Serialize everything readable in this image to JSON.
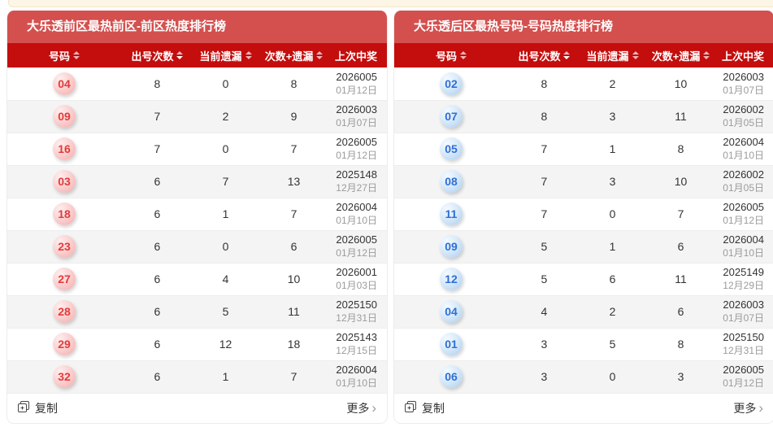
{
  "theme": {
    "title_bg": "#d4504e",
    "header_bg": "#c40d0d",
    "notice_bg": "#fdf6e6",
    "notice_border": "#f3e6c8",
    "sort_inactive": "#f0b6b6",
    "sort_active": "#ffffff",
    "ball_red_text": "#e23b3b",
    "ball_blue_text": "#2f6fd4"
  },
  "columns": [
    {
      "key": "number",
      "label": "号码",
      "sortable": true
    },
    {
      "key": "times",
      "label": "出号次数",
      "sortable": true,
      "active": "desc"
    },
    {
      "key": "current-miss",
      "label": "当前遗漏",
      "sortable": true
    },
    {
      "key": "times-plus-miss",
      "label": "次数+遗漏",
      "sortable": true
    },
    {
      "key": "last-win",
      "label": "上次中奖",
      "sortable": false
    }
  ],
  "footer": {
    "copy_label": "复制",
    "copy_icon": "copy-icon",
    "more_label": "更多",
    "more_chevron": "›"
  },
  "panels": [
    {
      "title": "大乐透前区最热前区-前区热度排行榜",
      "ball": "red",
      "rows": [
        {
          "num": "04",
          "times": "8",
          "miss": "0",
          "sum": "8",
          "period": "2026005",
          "date": "01月12日"
        },
        {
          "num": "09",
          "times": "7",
          "miss": "2",
          "sum": "9",
          "period": "2026003",
          "date": "01月07日"
        },
        {
          "num": "16",
          "times": "7",
          "miss": "0",
          "sum": "7",
          "period": "2026005",
          "date": "01月12日"
        },
        {
          "num": "03",
          "times": "6",
          "miss": "7",
          "sum": "13",
          "period": "2025148",
          "date": "12月27日"
        },
        {
          "num": "18",
          "times": "6",
          "miss": "1",
          "sum": "7",
          "period": "2026004",
          "date": "01月10日"
        },
        {
          "num": "23",
          "times": "6",
          "miss": "0",
          "sum": "6",
          "period": "2026005",
          "date": "01月12日"
        },
        {
          "num": "27",
          "times": "6",
          "miss": "4",
          "sum": "10",
          "period": "2026001",
          "date": "01月03日"
        },
        {
          "num": "28",
          "times": "6",
          "miss": "5",
          "sum": "11",
          "period": "2025150",
          "date": "12月31日"
        },
        {
          "num": "29",
          "times": "6",
          "miss": "12",
          "sum": "18",
          "period": "2025143",
          "date": "12月15日"
        },
        {
          "num": "32",
          "times": "6",
          "miss": "1",
          "sum": "7",
          "period": "2026004",
          "date": "01月10日"
        }
      ]
    },
    {
      "title": "大乐透后区最热号码-号码热度排行榜",
      "ball": "blue",
      "rows": [
        {
          "num": "02",
          "times": "8",
          "miss": "2",
          "sum": "10",
          "period": "2026003",
          "date": "01月07日"
        },
        {
          "num": "07",
          "times": "8",
          "miss": "3",
          "sum": "11",
          "period": "2026002",
          "date": "01月05日"
        },
        {
          "num": "05",
          "times": "7",
          "miss": "1",
          "sum": "8",
          "period": "2026004",
          "date": "01月10日"
        },
        {
          "num": "08",
          "times": "7",
          "miss": "3",
          "sum": "10",
          "period": "2026002",
          "date": "01月05日"
        },
        {
          "num": "11",
          "times": "7",
          "miss": "0",
          "sum": "7",
          "period": "2026005",
          "date": "01月12日"
        },
        {
          "num": "09",
          "times": "5",
          "miss": "1",
          "sum": "6",
          "period": "2026004",
          "date": "01月10日"
        },
        {
          "num": "12",
          "times": "5",
          "miss": "6",
          "sum": "11",
          "period": "2025149",
          "date": "12月29日"
        },
        {
          "num": "04",
          "times": "4",
          "miss": "2",
          "sum": "6",
          "period": "2026003",
          "date": "01月07日"
        },
        {
          "num": "01",
          "times": "3",
          "miss": "5",
          "sum": "8",
          "period": "2025150",
          "date": "12月31日"
        },
        {
          "num": "06",
          "times": "3",
          "miss": "0",
          "sum": "3",
          "period": "2026005",
          "date": "01月12日"
        }
      ]
    }
  ]
}
